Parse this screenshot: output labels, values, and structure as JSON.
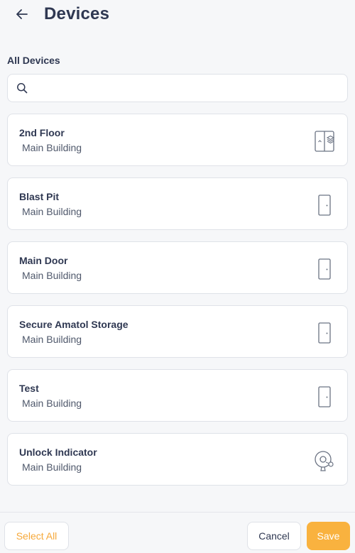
{
  "header": {
    "title": "Devices",
    "back_icon": "arrow-left-icon"
  },
  "section": {
    "label": "All Devices"
  },
  "search": {
    "placeholder": "",
    "value": "",
    "icon": "search-icon"
  },
  "devices": [
    {
      "name": "2nd Floor",
      "location": "Main Building",
      "icon": "elevator-icon"
    },
    {
      "name": "Blast Pit",
      "location": "Main Building",
      "icon": "door-icon"
    },
    {
      "name": "Main Door",
      "location": "Main Building",
      "icon": "door-icon"
    },
    {
      "name": "Secure Amatol Storage",
      "location": "Main Building",
      "icon": "door-icon"
    },
    {
      "name": "Test",
      "location": "Main Building",
      "icon": "door-icon"
    },
    {
      "name": "Unlock Indicator",
      "location": "Main Building",
      "icon": "siren-icon"
    }
  ],
  "footer": {
    "select_all_label": "Select All",
    "cancel_label": "Cancel",
    "save_label": "Save"
  },
  "colors": {
    "accent": "#f9b23f",
    "accent_text": "#f6a93b",
    "title": "#2f3852",
    "icon_stroke": "#6b7383"
  }
}
